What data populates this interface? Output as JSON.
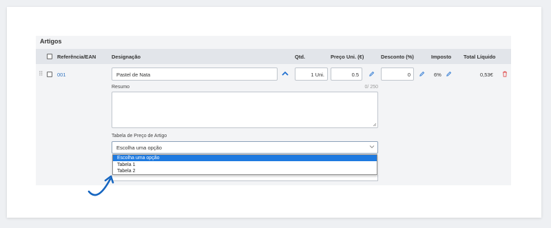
{
  "section": {
    "title": "Artigos"
  },
  "columns": {
    "ref": "Referência/EAN",
    "designacao": "Designação",
    "qtd": "Qtd.",
    "preco": "Preço Uni. (€)",
    "desconto": "Desconto (%)",
    "imposto": "Imposto",
    "total": "Total Líquido"
  },
  "row": {
    "ref": "001",
    "designacao": "Pastel de Nata",
    "qtd": "1 Uni.",
    "preco": "0.5",
    "desconto": "0",
    "imposto": "6%",
    "total": "0,53€"
  },
  "resumo": {
    "label": "Resumo",
    "counter": "0/ 250",
    "value": ""
  },
  "tabela": {
    "label": "Tabela de Preço de Artigo",
    "selected": "Escolha uma opção",
    "options": [
      "Escolha uma opção",
      "Tabela 1",
      "Tabela 2"
    ],
    "highlighted_index": 0
  },
  "icons": {
    "drag": "drag-handle-icon",
    "collapse": "chevron-up-icon",
    "edit": "pencil-icon",
    "delete": "trash-icon",
    "dropdown": "chevron-down-icon"
  },
  "colors": {
    "accent": "#1e7ae0",
    "link": "#2f74c0",
    "delete": "#e05050",
    "annotation": "#1565c0"
  }
}
